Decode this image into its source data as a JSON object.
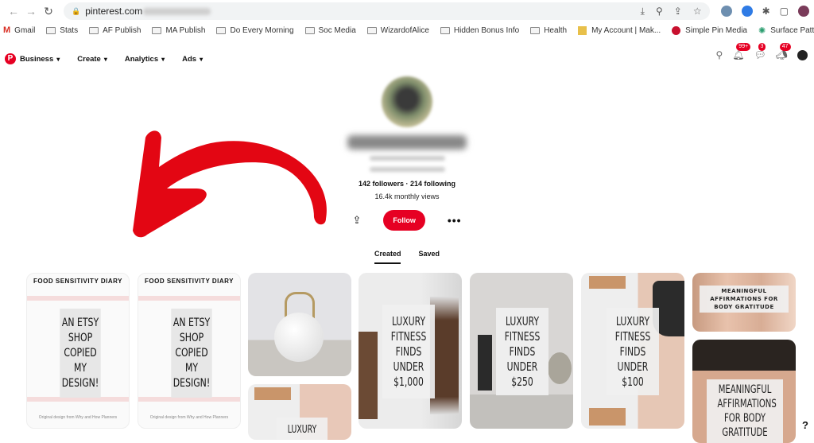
{
  "browser": {
    "url": "pinterest.com",
    "bookmarks": [
      {
        "label": "Gmail",
        "icon": "gmail-icon"
      },
      {
        "label": "Stats",
        "icon": "folder-icon"
      },
      {
        "label": "AF Publish",
        "icon": "folder-icon"
      },
      {
        "label": "MA Publish",
        "icon": "folder-icon"
      },
      {
        "label": "Do Every Morning",
        "icon": "folder-icon"
      },
      {
        "label": "Soc Media",
        "icon": "folder-icon"
      },
      {
        "label": "WizardofAlice",
        "icon": "folder-icon"
      },
      {
        "label": "Hidden Bonus Info",
        "icon": "folder-icon"
      },
      {
        "label": "Health",
        "icon": "folder-icon"
      },
      {
        "label": "My Account | Mak...",
        "icon": "site-icon"
      },
      {
        "label": "Simple Pin Media",
        "icon": "site-icon"
      },
      {
        "label": "Surface Pattern B...",
        "icon": "site-icon"
      }
    ]
  },
  "pinterest": {
    "menu": [
      {
        "label": "Business"
      },
      {
        "label": "Create"
      },
      {
        "label": "Analytics"
      },
      {
        "label": "Ads"
      }
    ],
    "badges": {
      "notifications": "99+",
      "messages": "3",
      "updates": "47"
    },
    "brand_color": "#e60023"
  },
  "profile": {
    "stats": "142 followers · 214 following",
    "monthly_views": "16.4k monthly views",
    "follow_label": "Follow",
    "more_label": "•••",
    "tabs": [
      {
        "label": "Created",
        "active": true
      },
      {
        "label": "Saved",
        "active": false
      }
    ]
  },
  "pins": [
    {
      "title": "FOOD SENSITIVITY DIARY",
      "overlay": [
        "AN ETSY",
        "SHOP",
        "COPIED",
        "MY",
        "DESIGN!"
      ],
      "footer": "Original design from Why and How Planners"
    },
    {
      "title": "FOOD SENSITIVITY DIARY",
      "overlay": [
        "AN ETSY",
        "SHOP",
        "COPIED",
        "MY",
        "DESIGN!"
      ],
      "footer": "Original design from Why and How Planners"
    },
    {
      "overlay": [
        "LUXURY",
        "FITNESS",
        "FINDS",
        "UNDER",
        "$1,000"
      ]
    },
    {
      "overlay": [
        "LUXURY",
        "FITNESS",
        "FINDS",
        "UNDER",
        "$250"
      ]
    },
    {
      "overlay": [
        "LUXURY",
        "FITNESS",
        "FINDS",
        "UNDER",
        "$100"
      ]
    },
    {
      "overlay": [
        "MEANINGFUL",
        "AFFIRMATIONS FOR",
        "BODY GRATITUDE"
      ]
    },
    {
      "overlay": [
        "MEANINGFUL",
        "AFFIRMATIONS",
        "FOR BODY",
        "GRATITUDE"
      ]
    },
    {
      "overlay": [
        "LUXURY"
      ]
    }
  ],
  "help_label": "?"
}
